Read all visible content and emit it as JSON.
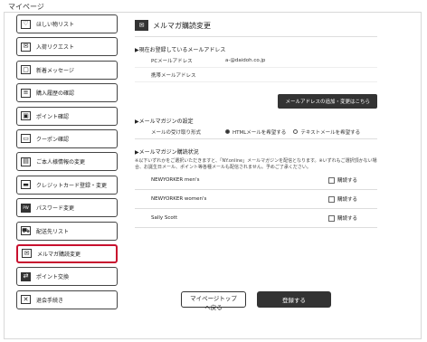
{
  "page": {
    "title": "マイページ"
  },
  "sidebar": {
    "items": [
      {
        "label": "ほしい物リスト",
        "icon": "heart-icon"
      },
      {
        "label": "入荷リクエスト",
        "icon": "mail-icon"
      },
      {
        "label": "新着メッセージ",
        "icon": "message-icon"
      },
      {
        "label": "購入履歴の確認",
        "icon": "list-icon"
      },
      {
        "label": "ポイント確認",
        "icon": "point-card-icon"
      },
      {
        "label": "クーポン確認",
        "icon": "coupon-icon"
      },
      {
        "label": "ご本人様情報の変更",
        "icon": "id-card-icon"
      },
      {
        "label": "クレジットカード登録・変更",
        "icon": "credit-card-icon"
      },
      {
        "label": "パスワード変更",
        "icon": "password-icon"
      },
      {
        "label": "配送先リスト",
        "icon": "truck-icon"
      },
      {
        "label": "メルマガ購読変更",
        "icon": "mail-icon",
        "active": true
      },
      {
        "label": "ポイント交換",
        "icon": "exchange-icon"
      },
      {
        "label": "退会手続き",
        "icon": "close-icon"
      }
    ]
  },
  "main": {
    "title": "メルマガ購読変更",
    "email_section": {
      "title": "▶現在お登録しているメールアドレス",
      "pc_label": "PCメールアドレス",
      "pc_value": "a-@daidoh.co.jp",
      "mobile_label": "携帯メールアドレス",
      "mobile_value": "",
      "button": "メールアドレスの追加・変更はこちら"
    },
    "settings_section": {
      "title": "▶メールマガジンの設定",
      "format_label": "メールの受け取り形式",
      "html_option": "HTMLメールを希望する",
      "text_option": "テキストメールを希望する"
    },
    "subscription_section": {
      "title": "▶メールマガジン購読状況",
      "note": "※以下いずれかをご選択いただきますと、「NY.online」メールマガジンを配信となります。※いずれもご選択頂かない場合、お誕生日メール、ポイント等各種メールも配信されません。予めご了承ください。",
      "checkbox_label": "購読する",
      "magazines": [
        "NEWYORKER men's",
        "NEWYORKER women's",
        "Sally Scott"
      ]
    },
    "buttons": {
      "back": "マイページトップへ戻る",
      "submit": "登録する"
    }
  }
}
